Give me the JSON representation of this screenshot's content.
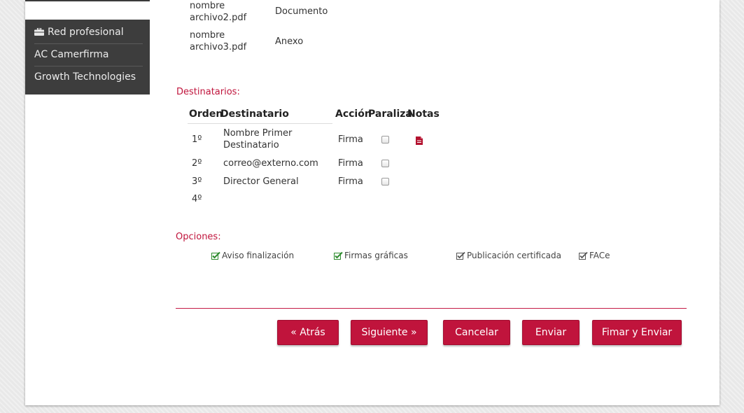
{
  "sidebar": {
    "items": [
      {
        "label": "Red profesional",
        "icon": "briefcase-icon"
      },
      {
        "label": "AC Camerfirma"
      },
      {
        "label": "Growth Technologies"
      }
    ]
  },
  "documents": [
    {
      "name": "nombre archivo2.pdf",
      "name_line1": "nombre",
      "name_line2": "archivo2.pdf",
      "type": "Documento"
    },
    {
      "name": "nombre archivo3.pdf",
      "name_line1": "nombre",
      "name_line2": "archivo3.pdf",
      "type": "Anexo"
    }
  ],
  "recipients": {
    "title": "Destinatarios:",
    "columns": [
      "Orden",
      "Destinatario",
      "Acción",
      "Paraliza",
      "Notas"
    ],
    "rows": [
      {
        "order": "1º",
        "name_line1": "Nombre Primer",
        "name_line2": "Destinatario",
        "action": "Firma",
        "paraliza": false,
        "has_note": true
      },
      {
        "order": "2º",
        "name_line1": "correo@externo.com",
        "action": "Firma",
        "paraliza": false
      },
      {
        "order": "3º",
        "name_line1": "Director General",
        "action": "Firma",
        "paraliza": false
      },
      {
        "order": "4º"
      }
    ]
  },
  "options": {
    "title": "Opciones:",
    "items": [
      {
        "label": "Aviso finalización",
        "checked": true
      },
      {
        "label": "Firmas gráficas",
        "checked": true
      },
      {
        "label": "Publicación certificada",
        "checked": true
      },
      {
        "label": "FACe",
        "checked": true
      }
    ]
  },
  "buttons": {
    "back": "« Atrás",
    "next": "Siguiente »",
    "cancel": "Cancelar",
    "send": "Enviar",
    "sign_send": "Fimar y Enviar"
  },
  "colors": {
    "accent": "#c0143c",
    "sidebar_bg": "#3d3d3d",
    "check_green": "#2e8b2e"
  }
}
